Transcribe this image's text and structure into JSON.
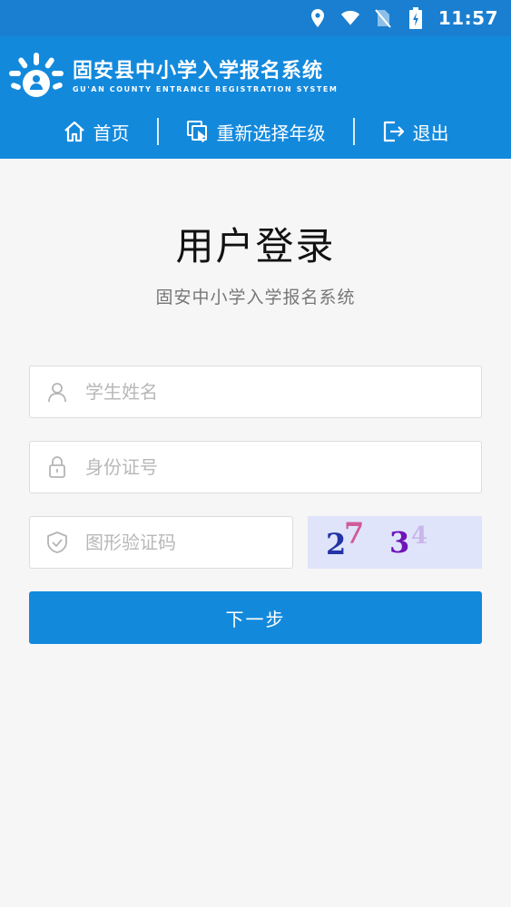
{
  "status_bar": {
    "time": "11:57",
    "icons": [
      "location-icon",
      "wifi-icon",
      "no-sim-icon",
      "battery-charging-icon"
    ]
  },
  "header": {
    "title": "固安县中小学入学报名系统",
    "subtitle": "GU'AN COUNTY ENTRANCE REGISTRATION SYSTEM",
    "nav": [
      {
        "label": "首页",
        "icon": "home-icon"
      },
      {
        "label": "重新选择年级",
        "icon": "reselect-icon"
      },
      {
        "label": "退出",
        "icon": "logout-icon"
      }
    ]
  },
  "login": {
    "title": "用户登录",
    "subtitle": "固安中小学入学报名系统",
    "fields": {
      "name": {
        "placeholder": "学生姓名",
        "value": "",
        "icon": "user-icon"
      },
      "id": {
        "placeholder": "身份证号",
        "value": "",
        "icon": "lock-icon"
      },
      "captcha": {
        "placeholder": "图形验证码",
        "value": "",
        "icon": "shield-icon"
      }
    },
    "captcha_image_text": "2734",
    "next_label": "下一步"
  },
  "colors": {
    "status_bar": "#1a7fd0",
    "header": "#1389dc",
    "button": "#1389dc",
    "background": "#f6f6f6"
  }
}
